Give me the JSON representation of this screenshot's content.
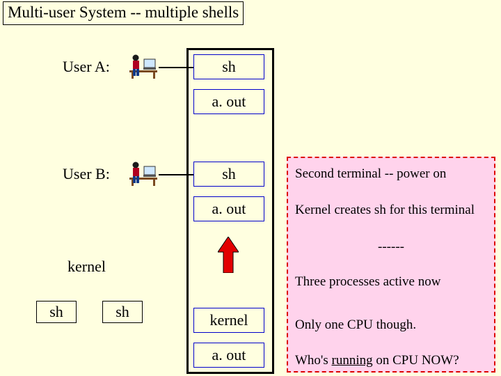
{
  "title": "Multi-user System -- multiple shells",
  "userA": {
    "label": "User A:"
  },
  "userB": {
    "label": "User B:"
  },
  "col": {
    "sh1": "sh",
    "aout1": "a. out",
    "sh2": "sh",
    "aout2": "a. out",
    "kernel": "kernel",
    "aout3": "a. out"
  },
  "kernel_label": "kernel",
  "sh_small_left": "sh",
  "sh_small_right": "sh",
  "notes": {
    "line1": "Second terminal  -- power on",
    "line2": "Kernel creates sh for this terminal",
    "dashes": "------",
    "line3": "Three processes active now",
    "line4": "Only one CPU though.",
    "line5_a": "Who's ",
    "line5_u": "running",
    "line5_b": " on CPU NOW?"
  }
}
